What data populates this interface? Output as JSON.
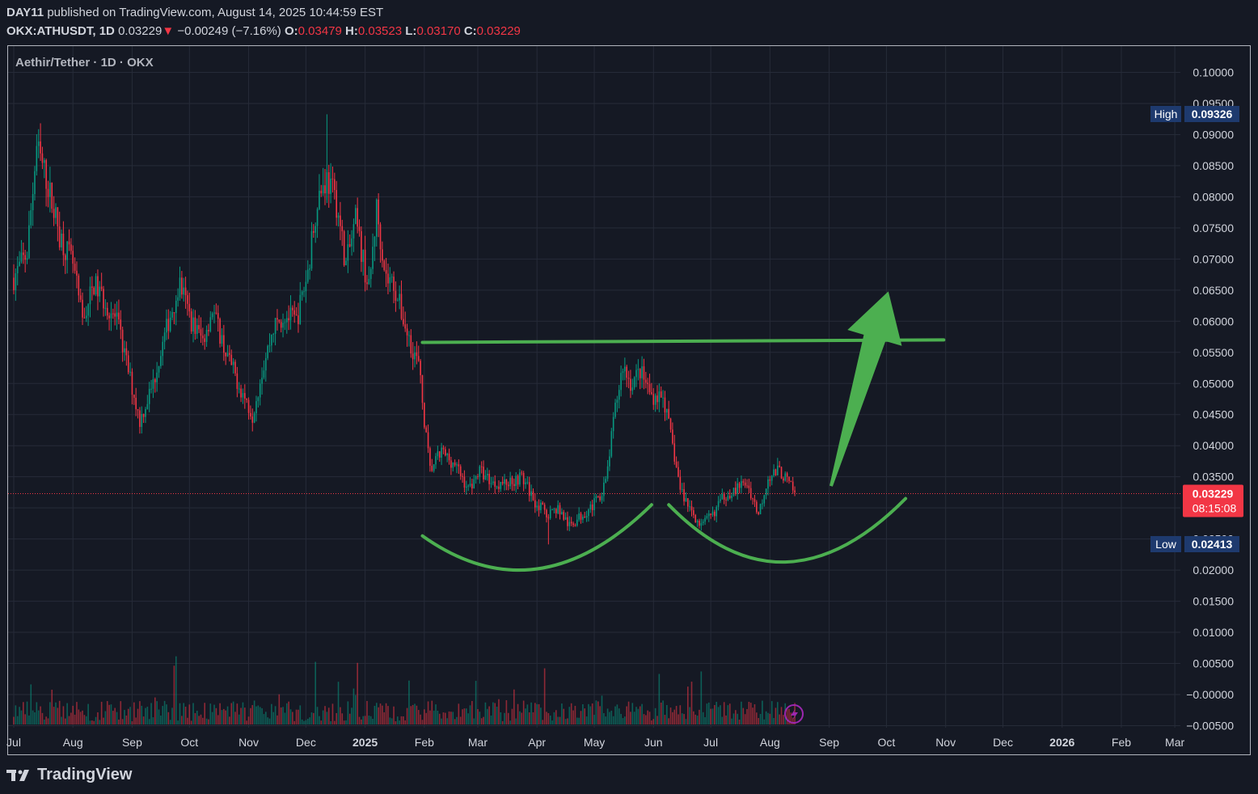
{
  "header": {
    "author": "DAY11",
    "published": " published on TradingView.com, August 14, 2025 10:44:59 EST",
    "symbol": "OKX:ATHUSDT, 1D",
    "last": "0.03229",
    "arrow": "▼",
    "change": "−0.00249 (−7.16%)",
    "o_label": "O:",
    "o": "0.03479",
    "h_label": "H:",
    "h": "0.03523",
    "l_label": "L:",
    "l": "0.03170",
    "c_label": "C:",
    "c": "0.03229"
  },
  "chart_title": "Aethir/Tether · 1D · OKX",
  "brand": "TradingView",
  "colors": {
    "up": "#089981",
    "down": "#f23645",
    "drawing": "#4caf50",
    "bg": "#151924",
    "grid": "#262b38"
  },
  "chart_data": {
    "type": "candlestick",
    "title": "Aethir/Tether · 1D · OKX",
    "x_ticks": [
      "Jul",
      "Aug",
      "Sep",
      "Oct",
      "Nov",
      "Dec",
      "2025",
      "Feb",
      "Mar",
      "Apr",
      "May",
      "Jun",
      "Jul",
      "Aug",
      "Sep",
      "Oct",
      "Nov",
      "Dec",
      "2026",
      "Feb",
      "Mar"
    ],
    "bold_ticks": [
      "2025",
      "2026"
    ],
    "y_ticks": [
      "0.10000",
      "0.09500",
      "0.09000",
      "0.08500",
      "0.08000",
      "0.07500",
      "0.07000",
      "0.06500",
      "0.06000",
      "0.05500",
      "0.05000",
      "0.04500",
      "0.04000",
      "0.03500",
      "0.03000",
      "0.02500",
      "0.02000",
      "0.01500",
      "0.01000",
      "0.00500",
      "−0.00000",
      "−0.00500"
    ],
    "ylim": [
      -0.005,
      0.1
    ],
    "high_label": "High",
    "high_value": "0.09326",
    "high": 0.09326,
    "low_label": "Low",
    "low_value": "0.02413",
    "low": 0.02413,
    "last_price": "0.03229",
    "last": 0.03229,
    "countdown": "08:15:08",
    "price_path": [
      [
        "2024-07-01",
        0.067
      ],
      [
        "2024-07-08",
        0.071
      ],
      [
        "2024-07-13",
        0.088
      ],
      [
        "2024-07-18",
        0.083
      ],
      [
        "2024-07-25",
        0.074
      ],
      [
        "2024-08-01",
        0.069
      ],
      [
        "2024-08-06",
        0.06
      ],
      [
        "2024-08-12",
        0.066
      ],
      [
        "2024-08-18",
        0.063
      ],
      [
        "2024-08-24",
        0.06
      ],
      [
        "2024-08-30",
        0.052
      ],
      [
        "2024-09-05",
        0.044
      ],
      [
        "2024-09-12",
        0.05
      ],
      [
        "2024-09-20",
        0.06
      ],
      [
        "2024-09-26",
        0.066
      ],
      [
        "2024-10-02",
        0.06
      ],
      [
        "2024-10-08",
        0.057
      ],
      [
        "2024-10-13",
        0.062
      ],
      [
        "2024-10-20",
        0.055
      ],
      [
        "2024-10-28",
        0.049
      ],
      [
        "2024-11-03",
        0.045
      ],
      [
        "2024-11-08",
        0.052
      ],
      [
        "2024-11-14",
        0.059
      ],
      [
        "2024-11-20",
        0.061
      ],
      [
        "2024-11-26",
        0.06
      ],
      [
        "2024-12-02",
        0.068
      ],
      [
        "2024-12-07",
        0.08
      ],
      [
        "2024-12-12",
        0.083
      ],
      [
        "2024-12-17",
        0.079
      ],
      [
        "2024-12-22",
        0.069
      ],
      [
        "2024-12-27",
        0.076
      ],
      [
        "2025-01-03",
        0.065
      ],
      [
        "2025-01-07",
        0.078
      ],
      [
        "2025-01-12",
        0.067
      ],
      [
        "2025-01-16",
        0.066
      ],
      [
        "2025-01-23",
        0.058
      ],
      [
        "2025-01-29",
        0.053
      ],
      [
        "2025-02-01",
        0.044
      ],
      [
        "2025-02-04",
        0.036
      ],
      [
        "2025-02-10",
        0.039
      ],
      [
        "2025-02-17",
        0.037
      ],
      [
        "2025-02-24",
        0.033
      ],
      [
        "2025-03-02",
        0.036
      ],
      [
        "2025-03-09",
        0.034
      ],
      [
        "2025-03-16",
        0.034
      ],
      [
        "2025-03-24",
        0.035
      ],
      [
        "2025-03-31",
        0.031
      ],
      [
        "2025-04-06",
        0.029
      ],
      [
        "2025-04-12",
        0.03
      ],
      [
        "2025-04-18",
        0.027
      ],
      [
        "2025-04-25",
        0.029
      ],
      [
        "2025-05-02",
        0.031
      ],
      [
        "2025-05-07",
        0.034
      ],
      [
        "2025-05-12",
        0.046
      ],
      [
        "2025-05-16",
        0.053
      ],
      [
        "2025-05-20",
        0.05
      ],
      [
        "2025-05-25",
        0.052
      ],
      [
        "2025-05-31",
        0.048
      ],
      [
        "2025-06-06",
        0.048
      ],
      [
        "2025-06-11",
        0.04
      ],
      [
        "2025-06-15",
        0.033
      ],
      [
        "2025-06-20",
        0.03
      ],
      [
        "2025-06-26",
        0.027
      ],
      [
        "2025-07-02",
        0.029
      ],
      [
        "2025-07-08",
        0.032
      ],
      [
        "2025-07-14",
        0.033
      ],
      [
        "2025-07-20",
        0.034
      ],
      [
        "2025-07-26",
        0.029
      ],
      [
        "2025-07-31",
        0.035
      ],
      [
        "2025-08-06",
        0.036
      ],
      [
        "2025-08-09",
        0.0348
      ],
      [
        "2025-08-14",
        0.03229
      ]
    ],
    "annotations": {
      "resistance_line": {
        "from": [
          "2025-01-31",
          0.0566
        ],
        "to": [
          "2025-10-31",
          0.057
        ]
      },
      "left_arc": [
        [
          "2025-01-31",
          0.0255
        ],
        [
          "2025-04-01",
          0.0202
        ],
        [
          "2025-05-31",
          0.0305
        ]
      ],
      "right_arc": [
        [
          "2025-06-09",
          0.0305
        ],
        [
          "2025-08-09",
          0.0213
        ],
        [
          "2025-10-11",
          0.0315
        ]
      ],
      "arrow": {
        "from": [
          "2025-09-02",
          0.0335
        ],
        "to": [
          "2025-10-02",
          0.0648
        ]
      }
    }
  }
}
